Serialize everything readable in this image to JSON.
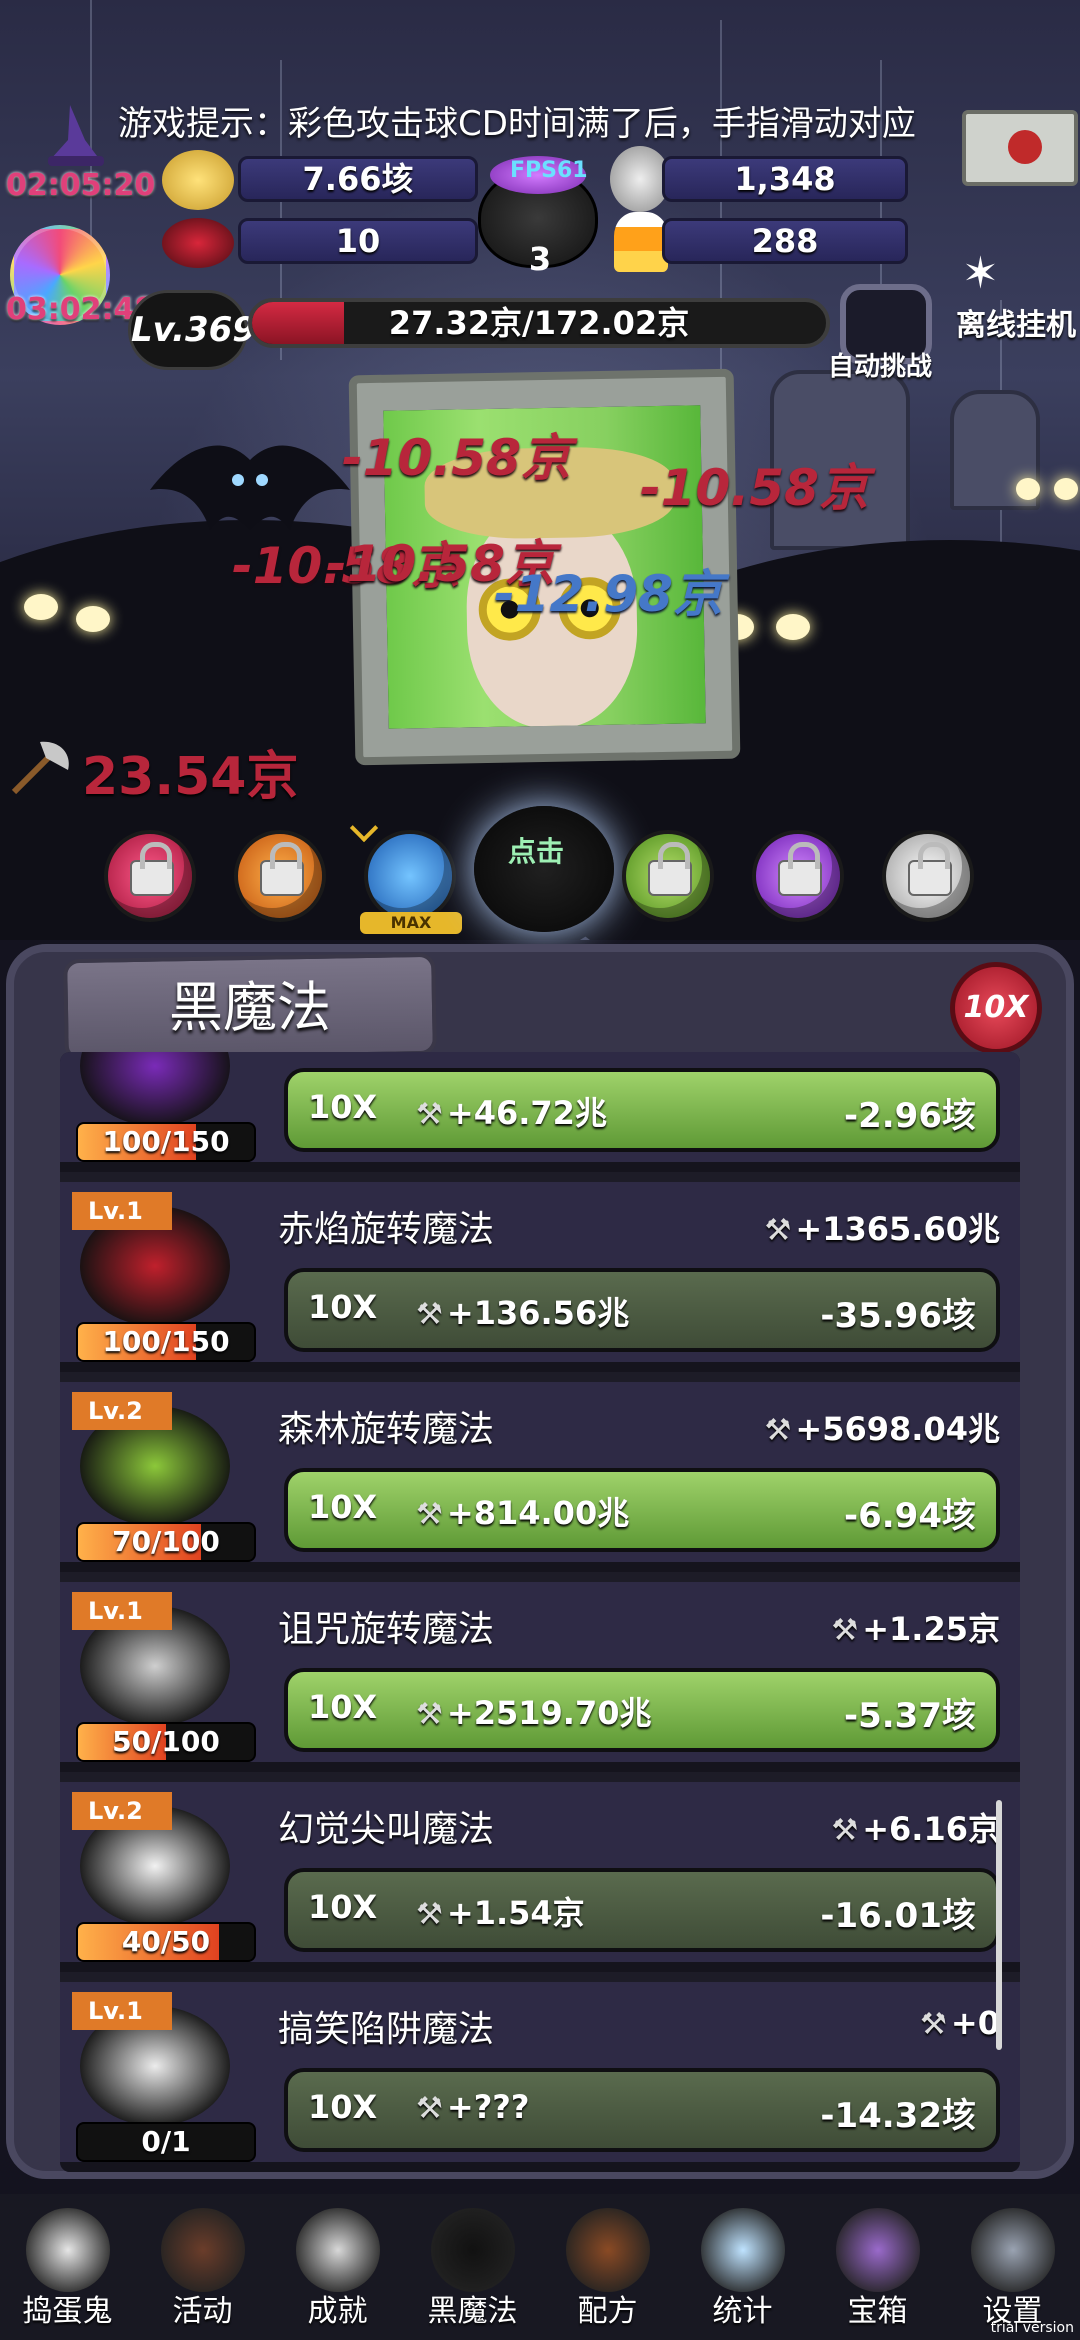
{
  "tip": "游戏提示：彩色攻击球CD时间满了后，手指滑动对应",
  "timers": {
    "top": "02:05:20",
    "bottom": "03:02:48"
  },
  "resources": {
    "coins": "7.66垓",
    "skulls": "1,348",
    "bows": "10",
    "candy_corn": "288",
    "cauldron_count": "3",
    "fps": "FPS61"
  },
  "offline_label": "离线挂机",
  "level": "Lv.369",
  "hp": {
    "text": "27.32京/172.02京",
    "fraction": 0.16
  },
  "auto_challenge": "自动挑战",
  "floating_damage": [
    {
      "text": "-10.58京",
      "style": "red"
    },
    {
      "text": "-10.58京",
      "style": "red"
    },
    {
      "text": "-10.58京",
      "style": "red"
    },
    {
      "text": "-10.58京",
      "style": "red"
    },
    {
      "text": "-12.98京",
      "style": "blue"
    }
  ],
  "axe_damage": "23.54京",
  "orbs": {
    "max_label": "MAX",
    "tap_label": "点击"
  },
  "panel": {
    "title": "黑魔法",
    "badge": "10X",
    "rows": [
      {
        "level": "",
        "name": "",
        "bonus": "",
        "count": "100/150",
        "fill": 0.67,
        "btn_style": "green",
        "btn_x": "10X",
        "gain": "+46.72兆",
        "cost": "-2.96垓",
        "thumb_color": "#7a2bb8"
      },
      {
        "level": "Lv.1",
        "name": "赤焰旋转魔法",
        "bonus": "+1365.60兆",
        "count": "100/150",
        "fill": 0.67,
        "btn_style": "gray",
        "btn_x": "10X",
        "gain": "+136.56兆",
        "cost": "-35.96垓",
        "thumb_color": "#c0202c"
      },
      {
        "level": "Lv.2",
        "name": "森林旋转魔法",
        "bonus": "+5698.04兆",
        "count": "70/100",
        "fill": 0.7,
        "btn_style": "green",
        "btn_x": "10X",
        "gain": "+814.00兆",
        "cost": "-6.94垓",
        "thumb_color": "#8cc83a"
      },
      {
        "level": "Lv.1",
        "name": "诅咒旋转魔法",
        "bonus": "+1.25京",
        "count": "50/100",
        "fill": 0.5,
        "btn_style": "green",
        "btn_x": "10X",
        "gain": "+2519.70兆",
        "cost": "-5.37垓",
        "thumb_color": "#cfcfcf"
      },
      {
        "level": "Lv.2",
        "name": "幻觉尖叫魔法",
        "bonus": "+6.16京",
        "count": "40/50",
        "fill": 0.8,
        "btn_style": "gray",
        "btn_x": "10X",
        "gain": "+1.54京",
        "cost": "-16.01垓",
        "thumb_color": "#f2f2f2"
      },
      {
        "level": "Lv.1",
        "name": "搞笑陷阱魔法",
        "bonus": "+0",
        "count": "0/1",
        "fill": 0,
        "btn_style": "gray",
        "btn_x": "10X",
        "gain": "+???",
        "cost": "-14.32垓",
        "thumb_color": "#ececec"
      }
    ]
  },
  "nav": [
    {
      "label": "捣蛋鬼",
      "icon": "ghost-icon",
      "color": "#e6e6e6"
    },
    {
      "label": "活动",
      "icon": "cupcake-icon",
      "color": "#6b3d2a"
    },
    {
      "label": "成就",
      "icon": "skull-trophy-icon",
      "color": "#d8d8d8"
    },
    {
      "label": "黑魔法",
      "icon": "black-cat-icon",
      "color": "#111111"
    },
    {
      "label": "配方",
      "icon": "spellbook-icon",
      "color": "#8a4a24"
    },
    {
      "label": "统计",
      "icon": "crystal-ball-icon",
      "color": "#bfe3ff"
    },
    {
      "label": "宝箱",
      "icon": "treasure-box-icon",
      "color": "#9a6acb"
    },
    {
      "label": "设置",
      "icon": "gear-icon",
      "color": "#9aa3b2"
    }
  ],
  "trial_label": "trial version"
}
